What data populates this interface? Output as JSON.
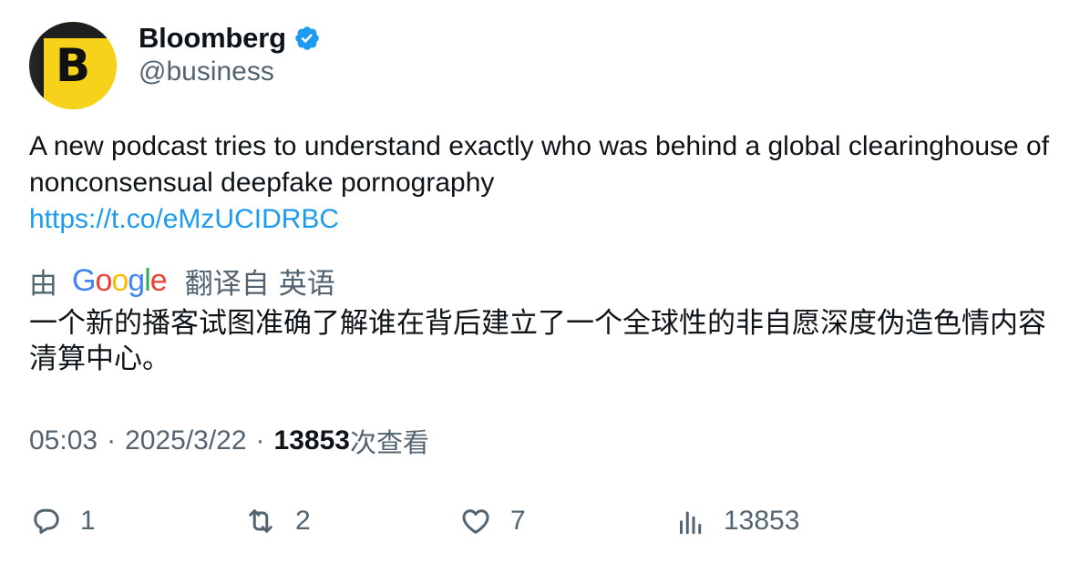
{
  "author": {
    "display_name": "Bloomberg",
    "handle": "@business",
    "avatar_letter": "B",
    "avatar_color": "#f7d21a",
    "verified": true,
    "verified_color": "#1d9bf0"
  },
  "tweet": {
    "text": "A new podcast tries to understand exactly who was behind a global clearinghouse of nonconsensual deepfake pornography",
    "link": "https://t.co/eMzUCIDRBC",
    "link_color": "#1d9bf0"
  },
  "translation": {
    "by_label": "由",
    "provider": "Google",
    "from_label": "翻译自",
    "language": "英语",
    "translated_text": "一个新的播客试图准确了解谁在背后建立了一个全球性的非自愿深度伪造色情内容清算中心。"
  },
  "meta": {
    "time": "05:03",
    "date": "2025/3/22",
    "views_count": "13853",
    "views_label": "次查看"
  },
  "actions": {
    "replies": "1",
    "retweets": "2",
    "likes": "7",
    "views": "13853"
  }
}
